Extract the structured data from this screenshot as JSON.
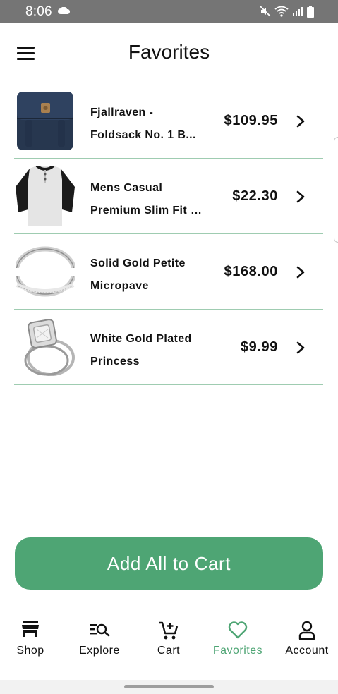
{
  "status_bar": {
    "time": "8:06",
    "icons": [
      "cloud-icon",
      "mute-icon",
      "wifi-icon",
      "signal-icon",
      "battery-icon"
    ]
  },
  "header": {
    "title": "Favorites",
    "menu_icon": "hamburger-menu-icon"
  },
  "favorites": [
    {
      "name_line1": "Fjallraven -",
      "name_line2": "Foldsack No. 1 B...",
      "price": "$109.95",
      "thumb": "backpack"
    },
    {
      "name_line1": "Mens Casual",
      "name_line2": "Premium Slim Fit T...",
      "price": "$22.30",
      "thumb": "raglan-shirt"
    },
    {
      "name_line1": "Solid Gold Petite",
      "name_line2": "Micropave",
      "price": "$168.00",
      "thumb": "ring-band"
    },
    {
      "name_line1": "White Gold Plated",
      "name_line2": "Princess",
      "price": "$9.99",
      "thumb": "engagement-ring"
    }
  ],
  "actions": {
    "add_all_label": "Add All to Cart"
  },
  "colors": {
    "accent": "#4ea574",
    "status_bar": "#757575",
    "text": "#111111"
  },
  "bottom_nav": {
    "active": "Favorites",
    "items": [
      {
        "label": "Shop",
        "icon": "store-icon"
      },
      {
        "label": "Explore",
        "icon": "search-list-icon"
      },
      {
        "label": "Cart",
        "icon": "cart-icon"
      },
      {
        "label": "Favorites",
        "icon": "heart-icon"
      },
      {
        "label": "Account",
        "icon": "user-icon"
      }
    ]
  }
}
